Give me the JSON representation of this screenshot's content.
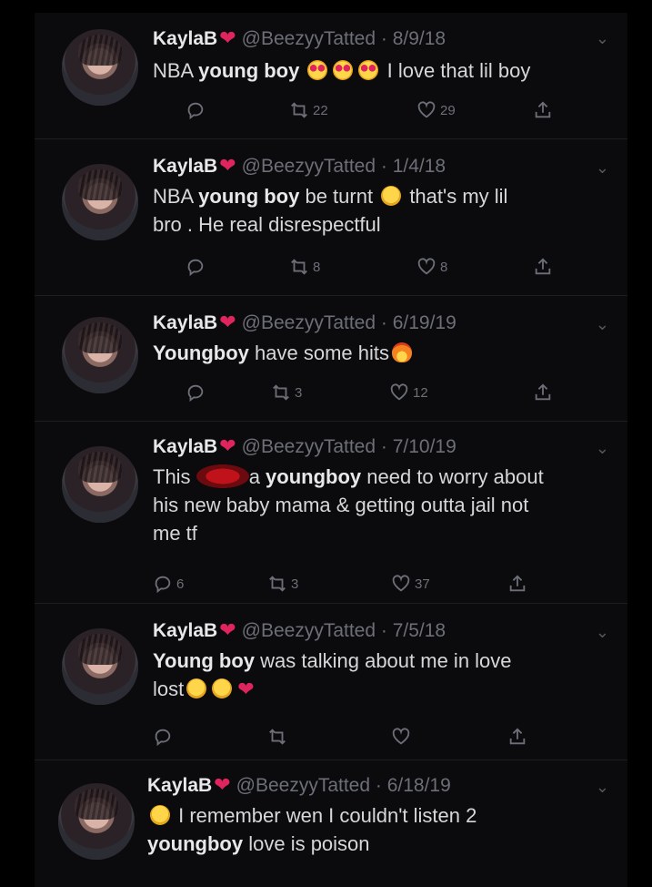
{
  "tweets": [
    {
      "name": "KaylaB",
      "handle": "@BeezyyTatted",
      "date": "8/9/18",
      "text_parts": [
        "NBA ",
        "young boy",
        " ",
        " I love that lil boy"
      ],
      "emojis": [
        "heart-eyes-emoji",
        "heart-eyes-emoji",
        "heart-eyes-emoji"
      ],
      "replies": "",
      "retweets": "22",
      "likes": "29"
    },
    {
      "name": "KaylaB",
      "handle": "@BeezyyTatted",
      "date": "1/4/18",
      "line1a": "NBA ",
      "line1b": "young boy",
      "line1c": " be turnt ",
      "line1d": " that's my lil",
      "line2": "bro . He real disrespectful",
      "emojis": [
        "laughing-emoji"
      ],
      "replies": "",
      "retweets": "8",
      "likes": "8"
    },
    {
      "name": "KaylaB",
      "handle": "@BeezyyTatted",
      "date": "6/19/19",
      "line1a": "Youngboy",
      "line1b": " have some hits",
      "emojis": [
        "fire-emoji"
      ],
      "replies": "",
      "retweets": "3",
      "likes": "12"
    },
    {
      "name": "KaylaB",
      "handle": "@BeezyyTatted",
      "date": "7/10/19",
      "line1a": "This ",
      "line1b": "a ",
      "line1c": "youngboy",
      "line1d": " need to worry about",
      "line2": "his new baby mama & getting outta jail not",
      "line3": "me tf",
      "replies": "6",
      "retweets": "3",
      "likes": "37"
    },
    {
      "name": "KaylaB",
      "handle": "@BeezyyTatted",
      "date": "7/5/18",
      "line1a": "Young boy",
      "line1b": " was talking about me in love",
      "line2": "lost",
      "emojis": [
        "crying-laughing-emoji",
        "weary-emoji",
        "red-heart-emoji"
      ],
      "replies": "",
      "retweets": "",
      "likes": ""
    },
    {
      "name": "KaylaB",
      "handle": "@BeezyyTatted",
      "date": "6/18/19",
      "line1": " I remember wen I couldn't listen 2",
      "line2a": "youngboy",
      "line2b": " love is poison",
      "emojis": [
        "laughing-emoji"
      ]
    }
  ],
  "separator": " · "
}
